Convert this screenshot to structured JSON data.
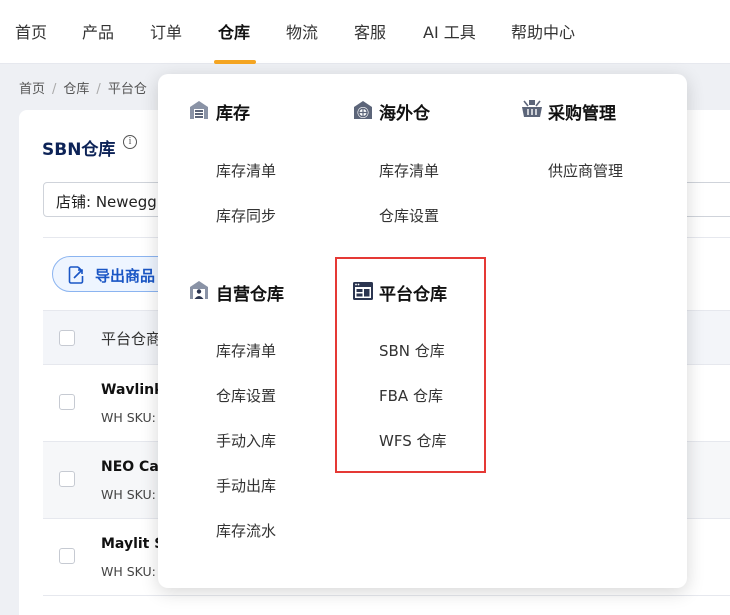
{
  "nav": {
    "items": [
      "首页",
      "产品",
      "订单",
      "仓库",
      "物流",
      "客服",
      "AI 工具",
      "帮助中心"
    ],
    "active": "仓库"
  },
  "breadcrumb": [
    "首页",
    "仓库",
    "平台仓"
  ],
  "page": {
    "title": "SBN仓库",
    "info_icon_glyph": "i",
    "store_select": "店铺: Newegg",
    "export_button": "导出商品",
    "table_header": "平台仓商"
  },
  "rows": [
    {
      "name": "Wavlink",
      "sku": "WH SKU:"
    },
    {
      "name": "NEO Car",
      "sku": "WH SKU:"
    },
    {
      "name": "Maylit Sr",
      "sku": "WH SKU:"
    }
  ],
  "menu": {
    "inventory": {
      "title": "库存",
      "icon": "warehouse-icon",
      "items": [
        "库存清单",
        "库存同步"
      ]
    },
    "overseas": {
      "title": "海外仓",
      "icon": "globe-warehouse-icon",
      "items": [
        "库存清单",
        "仓库设置"
      ]
    },
    "purchase": {
      "title": "采购管理",
      "icon": "basket-icon",
      "items": [
        "供应商管理"
      ]
    },
    "self_warehouse": {
      "title": "自营仓库",
      "icon": "self-warehouse-icon",
      "items": [
        "库存清单",
        "仓库设置",
        "手动入库",
        "手动出库",
        "库存流水"
      ]
    },
    "platform_warehouse": {
      "title": "平台仓库",
      "icon": "platform-window-icon",
      "items": [
        "SBN 仓库",
        "FBA 仓库",
        "WFS 仓库"
      ]
    }
  },
  "colors": {
    "accent_underline": "#f5a623",
    "title_navy": "#0d2357",
    "export_blue": "#1a56c5",
    "highlight_red": "#e53935"
  }
}
